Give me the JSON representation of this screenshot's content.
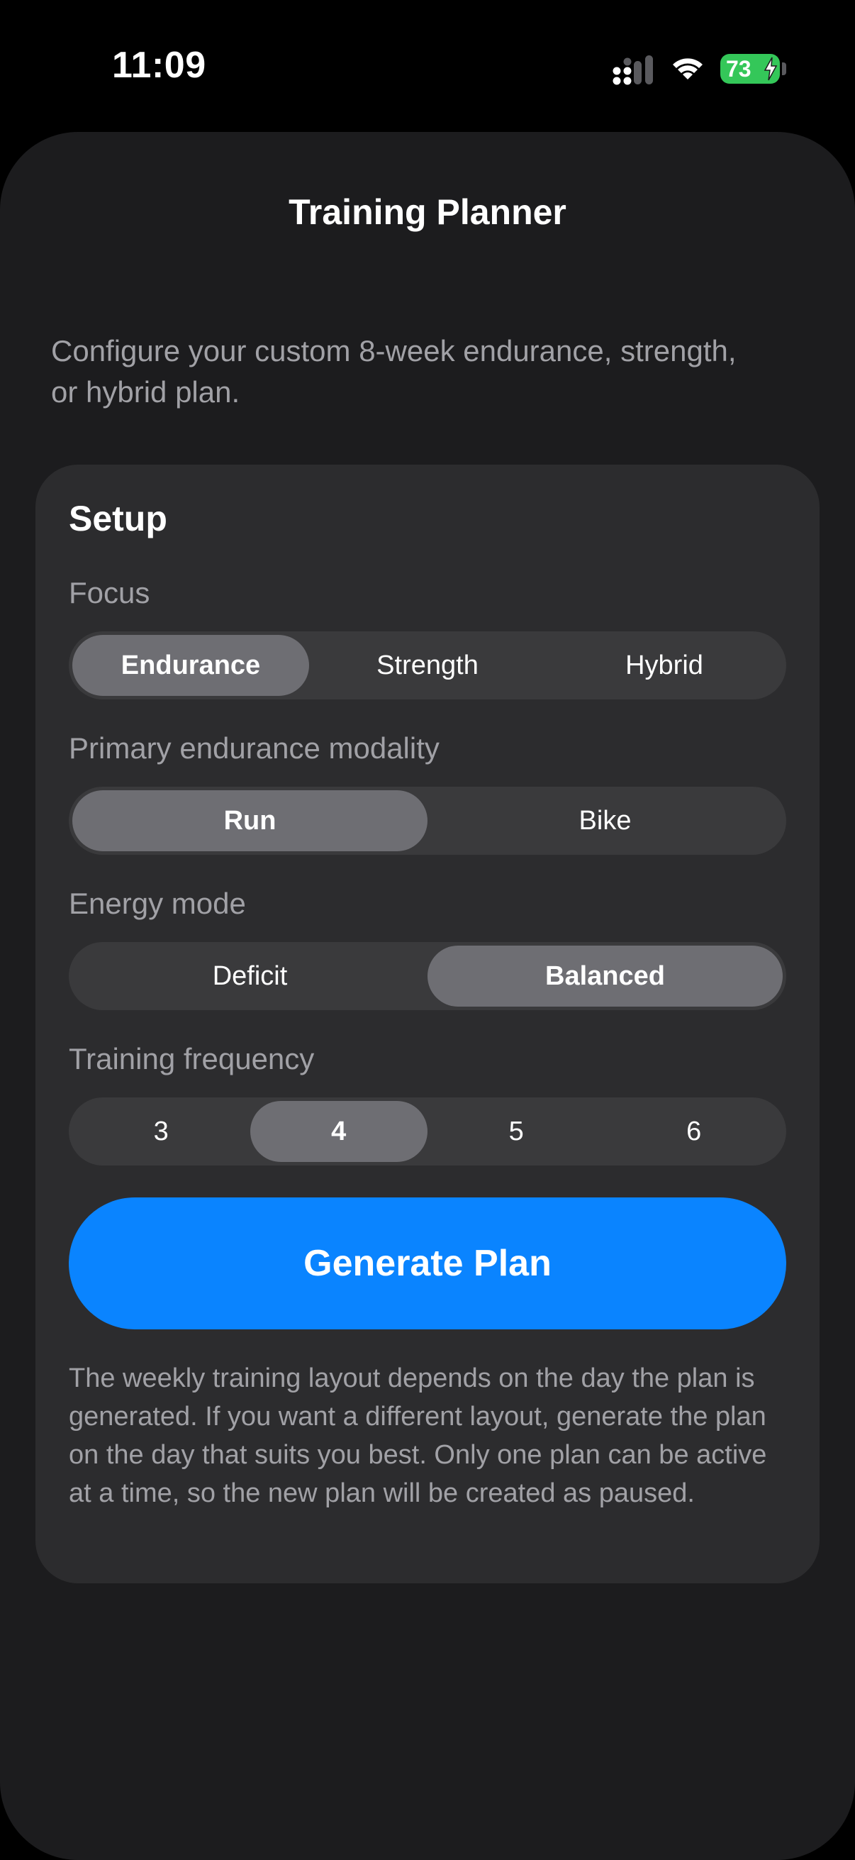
{
  "status_bar": {
    "time": "11:09",
    "battery_level": "73",
    "battery_charging": true,
    "icons": [
      "cellular-signal-icon",
      "wifi-icon",
      "battery-icon",
      "charging-bolt-icon"
    ]
  },
  "header": {
    "title": "Training Planner"
  },
  "intro": {
    "text": "Configure your custom 8-week endurance, strength, or hybrid plan."
  },
  "setup": {
    "title": "Setup",
    "focus": {
      "label": "Focus",
      "options": [
        "Endurance",
        "Strength",
        "Hybrid"
      ],
      "selected": "Endurance"
    },
    "modality": {
      "label": "Primary endurance modality",
      "options": [
        "Run",
        "Bike"
      ],
      "selected": "Run"
    },
    "energy": {
      "label": "Energy mode",
      "options": [
        "Deficit",
        "Balanced"
      ],
      "selected": "Balanced"
    },
    "frequency": {
      "label": "Training frequency",
      "options": [
        "3",
        "4",
        "5",
        "6"
      ],
      "selected": "4"
    },
    "generate_label": "Generate Plan",
    "note": "The weekly training layout depends on the day the plan is generated. If you want a different layout, generate the plan on the day that suits you best. Only one plan can be active at a time, so the new plan will be created as paused."
  },
  "colors": {
    "background": "#000000",
    "sheet": "#1c1c1e",
    "card": "#2c2c2e",
    "segment_track": "#3a3a3c",
    "segment_selected": "#6e6e73",
    "accent": "#0a84ff",
    "battery": "#34c759",
    "secondary_text": "#a1a1a6"
  }
}
